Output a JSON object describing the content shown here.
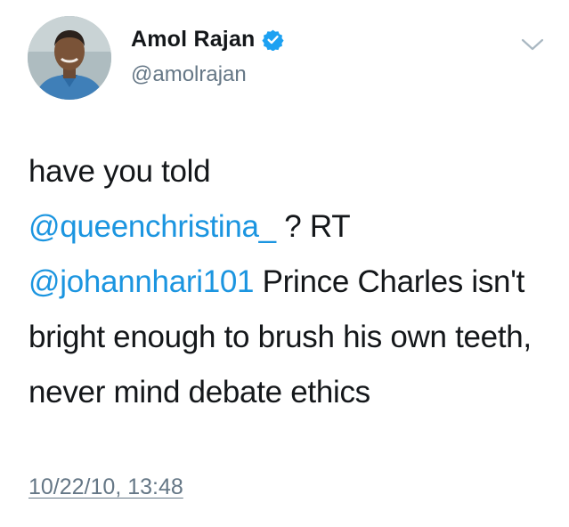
{
  "user": {
    "display_name": "Amol Rajan",
    "handle": "@amolrajan",
    "verified_icon": "verified-badge-icon",
    "avatar_icon": "user-avatar"
  },
  "menu": {
    "icon": "chevron-down-icon"
  },
  "tweet": {
    "line1": "have you told",
    "mention1": "@queenchristina_",
    "after_mention1": " ? RT",
    "mention2": "@johannhari101",
    "after_mention2": " Prince Charles isn't bright enough to brush his own teeth, never mind debate ethics",
    "timestamp": "10/22/10, 13:48"
  },
  "colors": {
    "link": "#1b95e0",
    "secondary": "#657786",
    "verified": "#1da1f2"
  }
}
